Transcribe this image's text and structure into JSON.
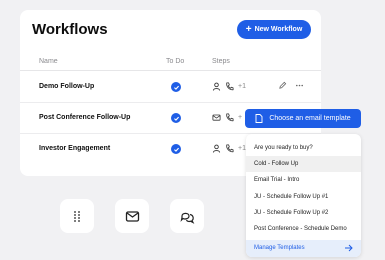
{
  "header": {
    "title": "Workflows",
    "new_button_label": "New Workflow"
  },
  "table": {
    "columns": [
      "Name",
      "To Do",
      "Steps"
    ],
    "rows": [
      {
        "name": "Demo Follow-Up",
        "steps_more": "+1"
      },
      {
        "name": "Post Conference Follow-Up",
        "steps_more": "+"
      },
      {
        "name": "Investor Engagement",
        "steps_more": "+1"
      }
    ]
  },
  "template_menu": {
    "button_label": "Choose an email template",
    "items": [
      "Are you ready to buy?",
      "Cold - Follow Up",
      "Email Trial - Intro",
      "JU - Schedule Follow Up #1",
      "JU - Schedule Follow Up #2",
      "Post Conference - Schedule Demo"
    ],
    "highlighted_index": 1,
    "footer_label": "Manage Templates"
  },
  "colors": {
    "accent": "#1f5ee6",
    "background": "#f1f1f3"
  }
}
